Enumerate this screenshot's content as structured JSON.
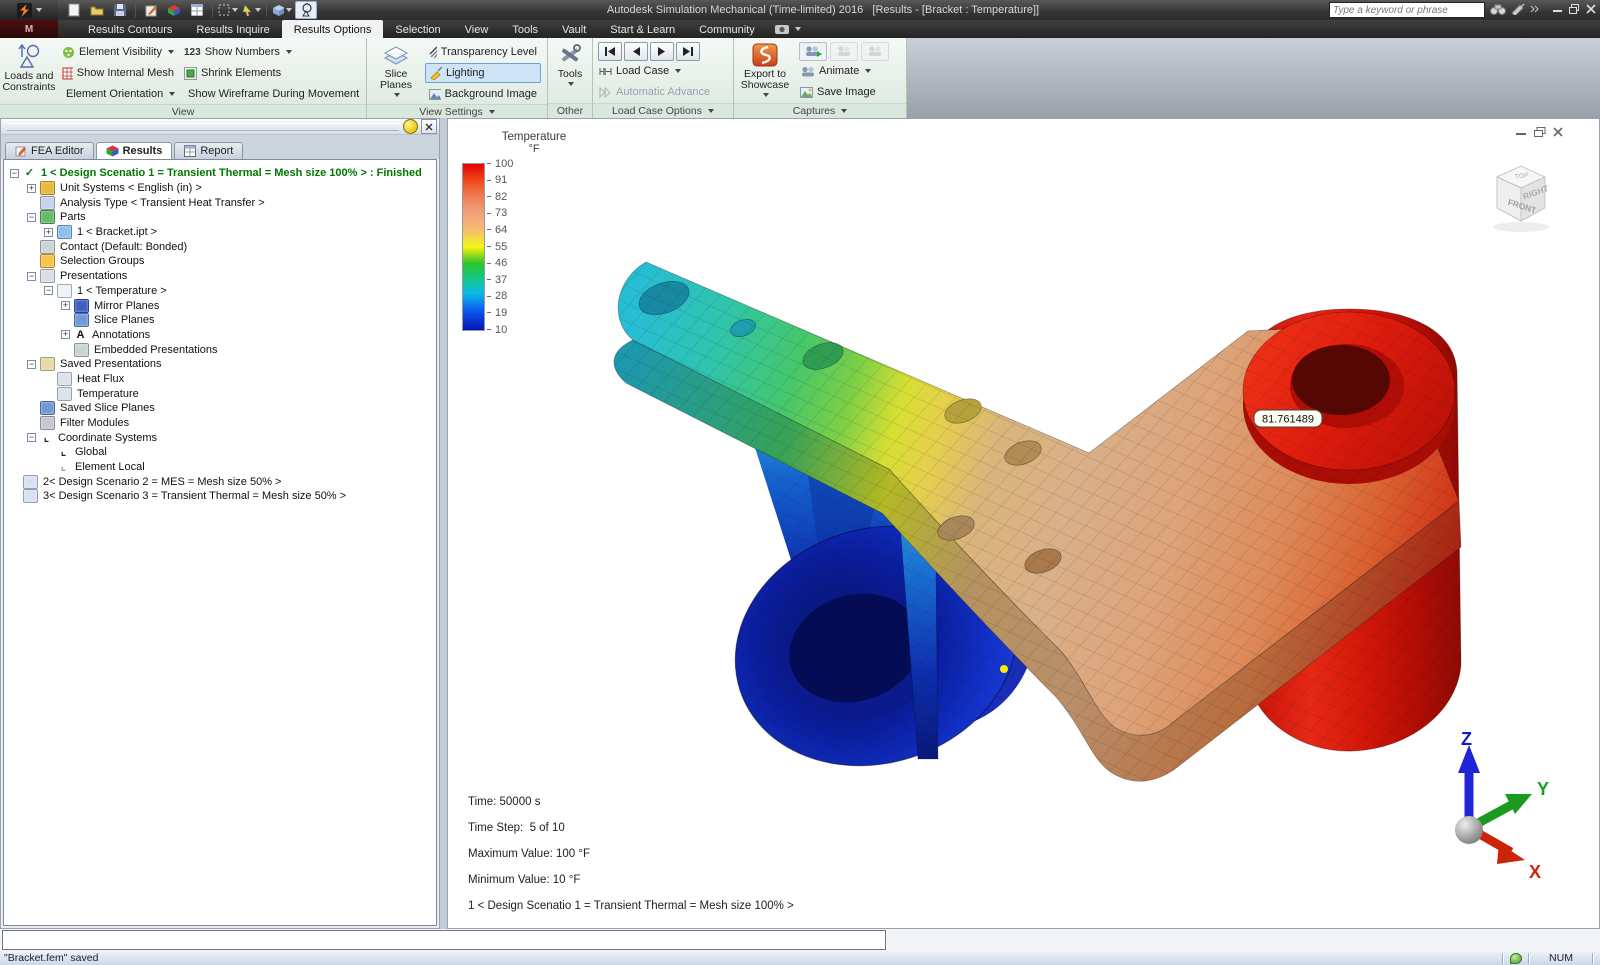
{
  "window": {
    "title": "Autodesk Simulation Mechanical (Time-limited) 2016   [Results - [Bracket : Temperature]]",
    "app_badge": "M",
    "search_placeholder": "Type a keyword or phrase",
    "status_left": "\"Bracket.fem\" saved",
    "status_num": "NUM"
  },
  "menu": {
    "tabs": [
      "Results Contours",
      "Results Inquire",
      "Results Options",
      "Selection",
      "View",
      "Tools",
      "Vault",
      "Start & Learn",
      "Community"
    ],
    "active": "Results Options"
  },
  "ribbon": {
    "groups": [
      {
        "label": "View"
      },
      {
        "label": "View Settings"
      },
      {
        "label": "Other"
      },
      {
        "label": "Load Case Options"
      },
      {
        "label": "Captures"
      }
    ],
    "buttons": {
      "loads": "Loads and Constraints",
      "element_visibility": "Element Visibility",
      "show_internal_mesh": "Show Internal Mesh",
      "element_orientation": "Element Orientation",
      "numbers_badge": "123",
      "show_numbers": "Show Numbers",
      "shrink_elements": "Shrink Elements",
      "show_wireframe": "Show Wireframe During Movement",
      "slice_planes": "Slice Planes",
      "transparency": "Transparency Level",
      "lighting": "Lighting",
      "background_image": "Background Image",
      "tools": "Tools",
      "load_case": "Load Case",
      "auto_advance": "Automatic Advance",
      "export_showcase": "Export to Showcase",
      "animate": "Animate",
      "save_image": "Save Image"
    }
  },
  "panel": {
    "tabs": [
      "FEA Editor",
      "Results",
      "Report"
    ],
    "active_tab": "Results",
    "tree": [
      {
        "level": 0,
        "expand": "minus",
        "icon": "scenario-check-icon",
        "label": "1 < Design Scenatio 1 = Transient Thermal = Mesh size 100% > : Finished",
        "cls": "finished"
      },
      {
        "level": 1,
        "expand": "plus",
        "icon": "unit-systems-icon",
        "label": "Unit Systems < English (in) >"
      },
      {
        "level": 1,
        "expand": null,
        "icon": "analysis-type-icon",
        "label": "Analysis Type < Transient Heat Transfer >"
      },
      {
        "level": 1,
        "expand": "minus",
        "icon": "parts-icon",
        "label": "Parts"
      },
      {
        "level": 2,
        "expand": "plus",
        "icon": "part-cube-icon",
        "label": "1 < Bracket.ipt >"
      },
      {
        "level": 1,
        "expand": null,
        "icon": "contact-icon",
        "label": "Contact (Default: Bonded)"
      },
      {
        "level": 1,
        "expand": null,
        "icon": "folder-icon",
        "label": "Selection Groups"
      },
      {
        "level": 1,
        "expand": "minus",
        "icon": "presentations-icon",
        "label": "Presentations"
      },
      {
        "level": 2,
        "expand": "minus",
        "icon": "presentation-icon",
        "label": "1 < Temperature >"
      },
      {
        "level": 3,
        "expand": "plus",
        "icon": "mirror-planes-icon",
        "label": "Mirror Planes"
      },
      {
        "level": 3,
        "expand": null,
        "icon": "slice-planes-tree-icon",
        "label": "Slice Planes"
      },
      {
        "level": 3,
        "expand": "plus",
        "icon": "annotations-icon",
        "label": "Annotations"
      },
      {
        "level": 3,
        "expand": null,
        "icon": "embedded-presentations-icon",
        "label": "Embedded Presentations"
      },
      {
        "level": 1,
        "expand": "minus",
        "icon": "saved-presentations-icon",
        "label": "Saved Presentations"
      },
      {
        "level": 2,
        "expand": null,
        "icon": "saved-presentation-icon",
        "label": "Heat Flux"
      },
      {
        "level": 2,
        "expand": null,
        "icon": "saved-presentation-icon",
        "label": "Temperature"
      },
      {
        "level": 1,
        "expand": null,
        "icon": "slice-planes-tree-icon",
        "label": "Saved Slice Planes"
      },
      {
        "level": 1,
        "expand": null,
        "icon": "filter-icon",
        "label": "Filter Modules"
      },
      {
        "level": 1,
        "expand": "minus",
        "icon": "axis-icon",
        "label": "Coordinate Systems"
      },
      {
        "level": 2,
        "expand": null,
        "icon": "axis-icon",
        "label": "Global"
      },
      {
        "level": 2,
        "expand": null,
        "icon": "axis-gray-icon",
        "label": "Element Local"
      },
      {
        "level": 0,
        "expand": null,
        "icon": "scenario-icon",
        "label": "2< Design Scenario 2 = MES = Mesh size 50% >"
      },
      {
        "level": 0,
        "expand": null,
        "icon": "scenario-icon",
        "label": "3< Design Scenario 3 = Transient Thermal = Mesh size 50% >"
      }
    ]
  },
  "icons": {
    "scenario-check-icon": {
      "glyph": "✓",
      "fg": "#1c6e1c"
    },
    "unit-systems-icon": {
      "bg": "#e8b93c"
    },
    "analysis-type-icon": {
      "bg": "#c7d3ea"
    },
    "parts-icon": {
      "bg": "#66bb6a"
    },
    "part-cube-icon": {
      "bg": "#90bff0"
    },
    "contact-icon": {
      "bg": "#cfd2da"
    },
    "folder-icon": {
      "bg": "#f6c64a"
    },
    "presentations-icon": {
      "bg": "#dadee6"
    },
    "presentation-icon": {
      "bg": "#eef2fa"
    },
    "mirror-planes-icon": {
      "bg": "#3f5fc4"
    },
    "slice-planes-tree-icon": {
      "bg": "#6f9ad8"
    },
    "annotations-icon": {
      "glyph": "A",
      "fg": "#111"
    },
    "embedded-presentations-icon": {
      "bg": "#c9d6cf"
    },
    "saved-presentations-icon": {
      "bg": "#e7d9a8"
    },
    "saved-presentation-icon": {
      "bg": "#dde2ec"
    },
    "filter-icon": {
      "bg": "#c4c8d2"
    },
    "axis-icon": {
      "glyph": "⌞",
      "fg": "#222"
    },
    "axis-gray-icon": {
      "glyph": "⌞",
      "fg": "#999"
    },
    "scenario-icon": {
      "bg": "#d8e2f2"
    }
  },
  "viewport": {
    "legend": {
      "title": "Temperature",
      "unit": "°F",
      "ticks": [
        100,
        91,
        82,
        73,
        64,
        55,
        46,
        37,
        28,
        19,
        10
      ]
    },
    "tooltip": "81.761489",
    "info_lines": [
      "Time: 50000 s",
      "Time Step:  5 of 10",
      "Maximum Value: 100 °F",
      "Minimum Value: 10 °F",
      "1 < Design Scenatio 1 = Transient Thermal = Mesh size 100% >"
    ],
    "viewcube": {
      "front": "FRONT",
      "right": "RIGHT",
      "top": "TOP"
    },
    "axes": {
      "x": "X",
      "y": "Y",
      "z": "Z"
    }
  }
}
